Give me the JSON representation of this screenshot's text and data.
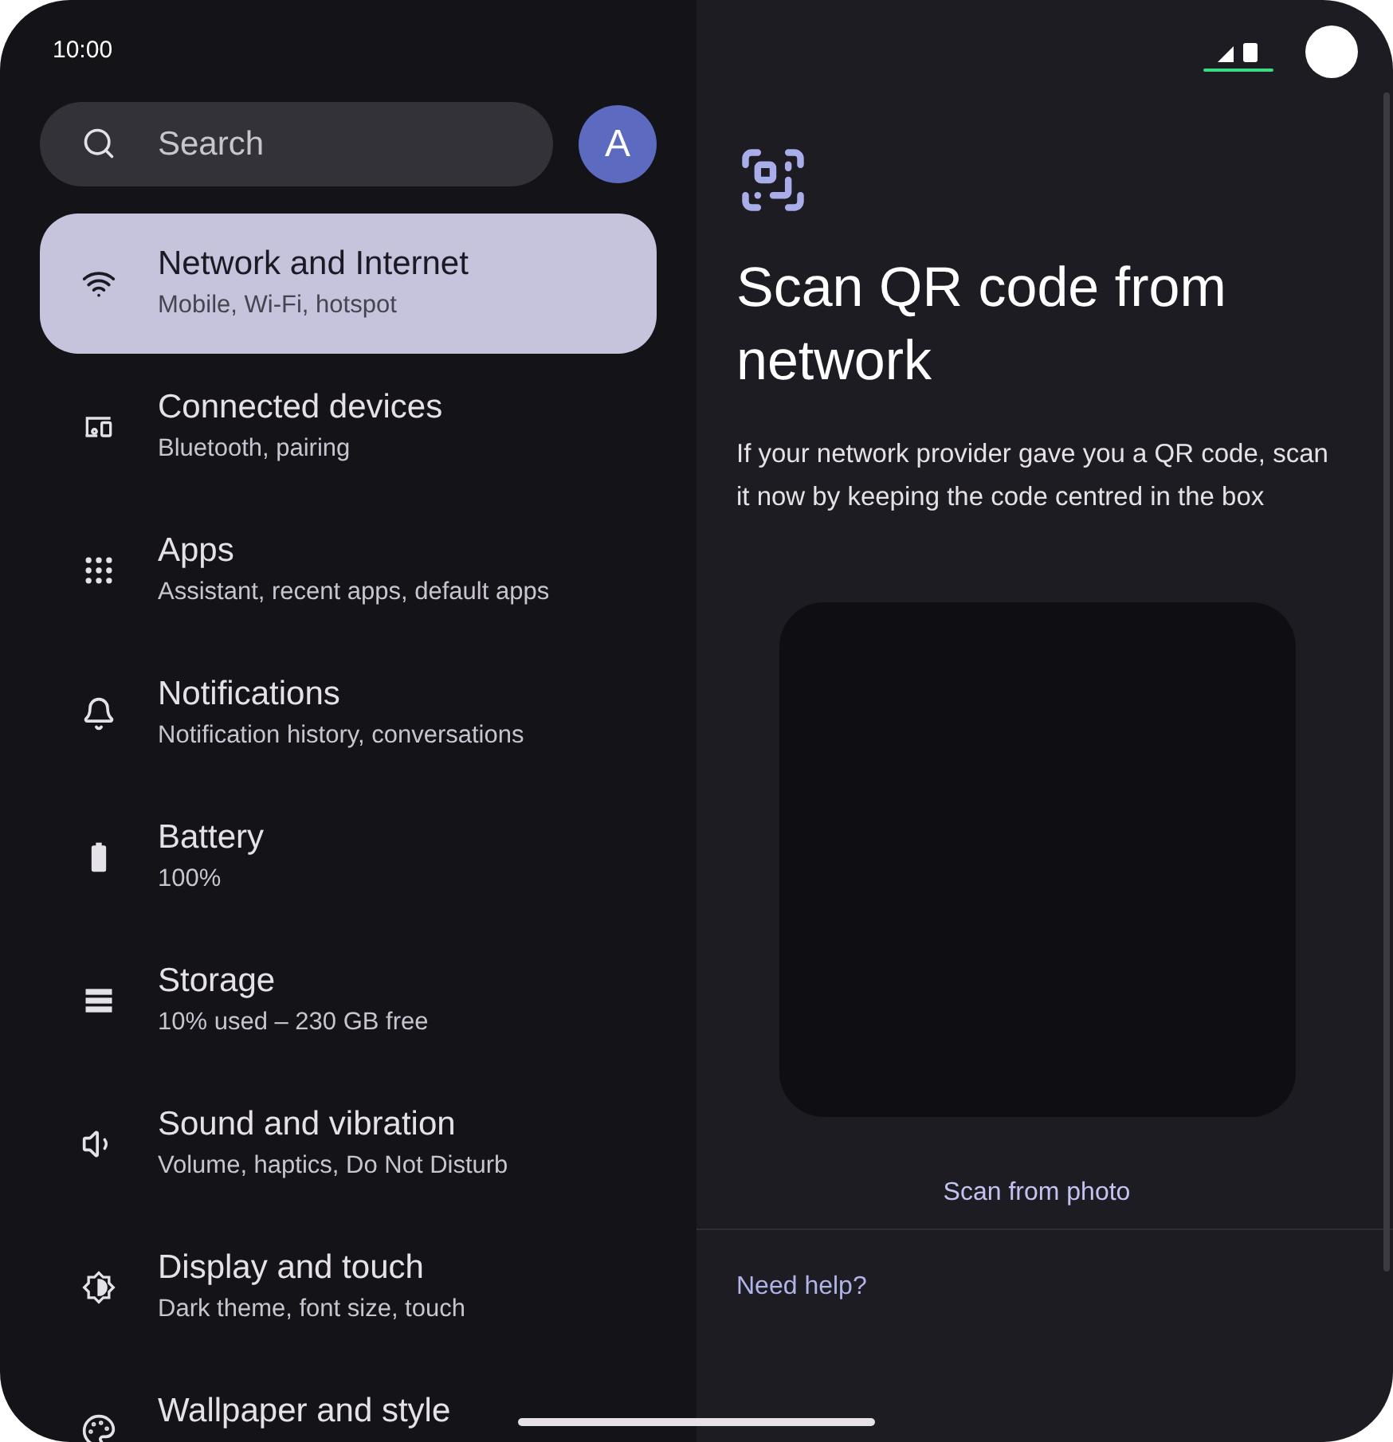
{
  "status_bar": {
    "time": "10:00"
  },
  "search": {
    "placeholder": "Search"
  },
  "account": {
    "initial": "A"
  },
  "settings": [
    {
      "title": "Network and Internet",
      "subtitle": "Mobile, Wi-Fi, hotspot",
      "selected": true
    },
    {
      "title": "Connected devices",
      "subtitle": "Bluetooth, pairing",
      "selected": false
    },
    {
      "title": "Apps",
      "subtitle": "Assistant, recent apps, default apps",
      "selected": false
    },
    {
      "title": "Notifications",
      "subtitle": "Notification history, conversations",
      "selected": false
    },
    {
      "title": "Battery",
      "subtitle": "100%",
      "selected": false
    },
    {
      "title": "Storage",
      "subtitle": "10% used – 230 GB free",
      "selected": false
    },
    {
      "title": "Sound and vibration",
      "subtitle": "Volume, haptics, Do Not Disturb",
      "selected": false
    },
    {
      "title": "Display and touch",
      "subtitle": "Dark theme, font size, touch",
      "selected": false
    },
    {
      "title": "Wallpaper and style",
      "selected": false
    }
  ],
  "qr_panel": {
    "title": "Scan QR code from network",
    "description": "If your network provider gave you a QR code, scan it now by keeping the code centred in the box",
    "scan_link": "Scan from photo",
    "help_link": "Need help?"
  }
}
